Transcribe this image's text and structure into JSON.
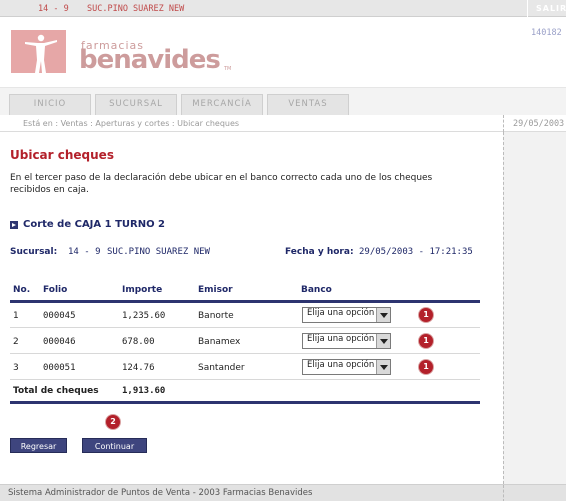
{
  "topbar": {
    "code": "14 - 9",
    "branch": "SUC.PINO SUAREZ NEW",
    "salir": "SALIR"
  },
  "header": {
    "logo_small": "farmacias",
    "logo_big": "benavides",
    "logo_tm": "TM",
    "ref": "140182"
  },
  "tabs": [
    "INICIO",
    "SUCURSAL",
    "MERCANCÍA",
    "VENTAS"
  ],
  "breadcrumb": "Está en : Ventas : Aperturas y cortes : Ubicar cheques",
  "date_right": "29/05/2003",
  "main": {
    "title": "Ubicar cheques",
    "description": "En el tercer paso de la declaración debe ubicar en el banco correcto cada uno de los cheques recibidos en caja.",
    "section_title": "Corte de CAJA 1 TURNO 2",
    "sucursal_label": "Sucursal:",
    "sucursal_code": "14 - 9",
    "sucursal_name": "SUC.PINO SUAREZ NEW",
    "fecha_label": "Fecha y hora:",
    "fecha_value": "29/05/2003 - 17:21:35"
  },
  "table": {
    "headers": {
      "no": "No.",
      "folio": "Folio",
      "importe": "Importe",
      "emisor": "Emisor",
      "banco": "Banco"
    },
    "rows": [
      {
        "no": "1",
        "folio": "000045",
        "importe": "1,235.60",
        "emisor": "Banorte",
        "banco": "Elija una opción"
      },
      {
        "no": "2",
        "folio": "000046",
        "importe": "678.00",
        "emisor": "Banamex",
        "banco": "Elija una opción"
      },
      {
        "no": "3",
        "folio": "000051",
        "importe": "124.76",
        "emisor": "Santander",
        "banco": "Elija una opción"
      }
    ],
    "total_label": "Total de cheques",
    "total_value": "1,913.60"
  },
  "badges": {
    "row_marker": "1",
    "continue_marker": "2"
  },
  "buttons": {
    "back": "Regresar",
    "continue": "Continuar"
  },
  "footer": "Sistema Administrador de Puntos de Venta - 2003 Farmacias Benavides",
  "colors": {
    "accent_red": "#b3202a",
    "navy": "#2d3470",
    "logo_pink": "#e6a7a7"
  }
}
